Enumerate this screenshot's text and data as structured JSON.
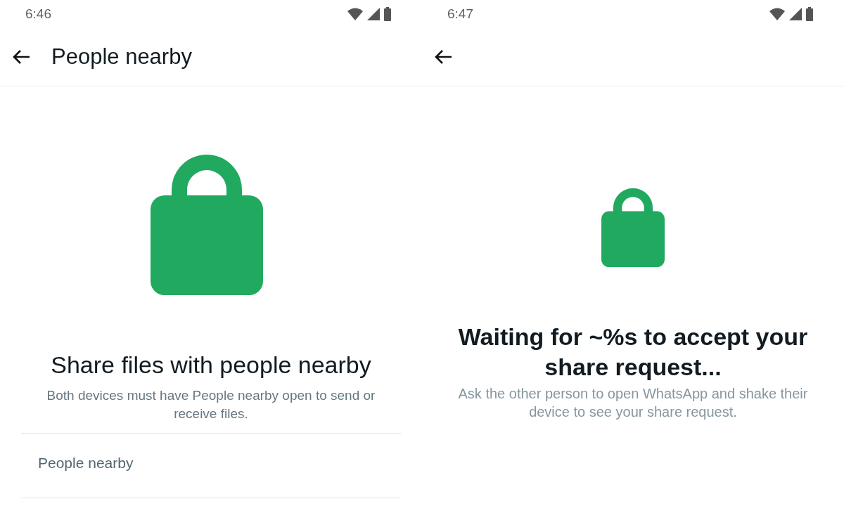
{
  "screens": [
    {
      "kind": "intro",
      "status_bar": {
        "time": "6:46"
      },
      "toolbar": {
        "title": "People nearby"
      },
      "heading": "Share files with people nearby",
      "description": "Both devices must have People nearby open to send or receive files.",
      "section_header": "People nearby"
    },
    {
      "kind": "waiting",
      "status_bar": {
        "time": "6:47"
      },
      "heading": "Waiting for ~%s to accept your share request...",
      "description": "Ask the other person to open WhatsApp and shake their device to see your share request."
    }
  ]
}
